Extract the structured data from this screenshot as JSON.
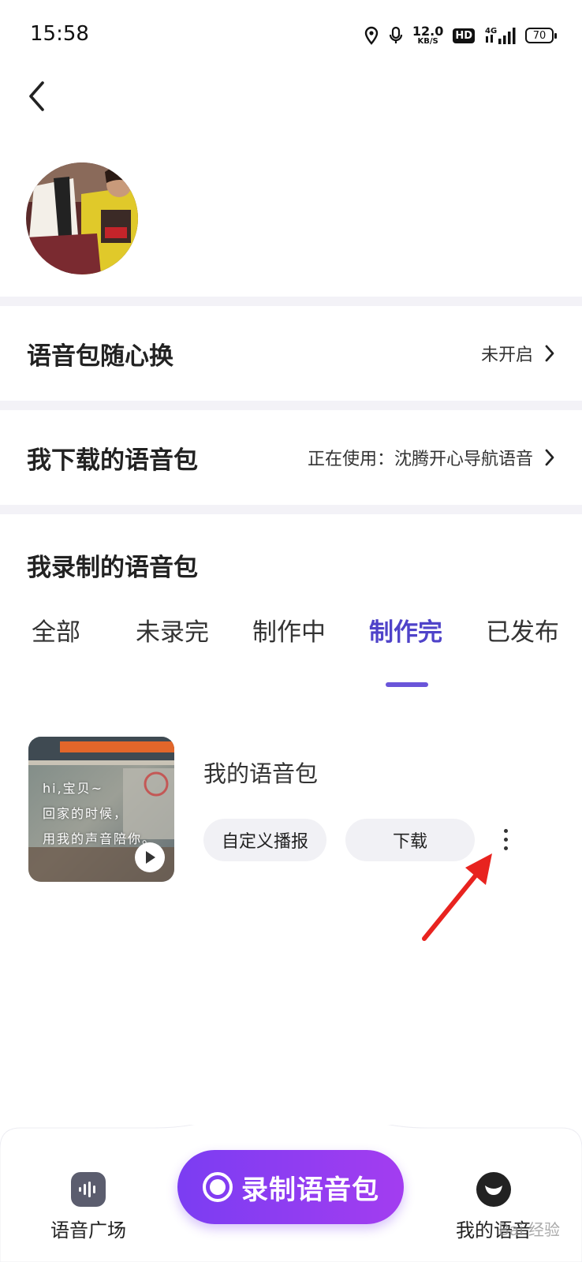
{
  "status_bar": {
    "time": "15:58",
    "net_speed_value": "12.0",
    "net_speed_unit": "KB/S",
    "hd_badge": "HD",
    "network": "4G",
    "battery": "70"
  },
  "profile": {
    "avatar_icon": "user-avatar-photo"
  },
  "rows": {
    "voice_switch_label": "语音包随心换",
    "voice_switch_value": "未开启",
    "downloaded_label": "我下载的语音包",
    "downloaded_value": "正在使用：沈腾开心导航语音"
  },
  "recorded": {
    "title": "我录制的语音包",
    "tabs": [
      "全部",
      "未录完",
      "制作中",
      "制作完",
      "已发布"
    ],
    "active_tab": "制作完"
  },
  "card": {
    "cover_line1": "hi,宝贝~",
    "cover_line2": "回家的时候，",
    "cover_line3": "用我的声音陪你。",
    "name": "我的语音包",
    "custom_button": "自定义播报",
    "download_button": "下载"
  },
  "bottom_nav": {
    "plaza_label": "语音广场",
    "record_label": "录制语音包",
    "mine_label": "我的语音"
  },
  "watermark": "Bai 经验",
  "colors": {
    "accent": "#4f43c9",
    "record_gradient_start": "#7b3df2",
    "record_gradient_end": "#a33df0",
    "arrow_red": "#e8231f"
  }
}
